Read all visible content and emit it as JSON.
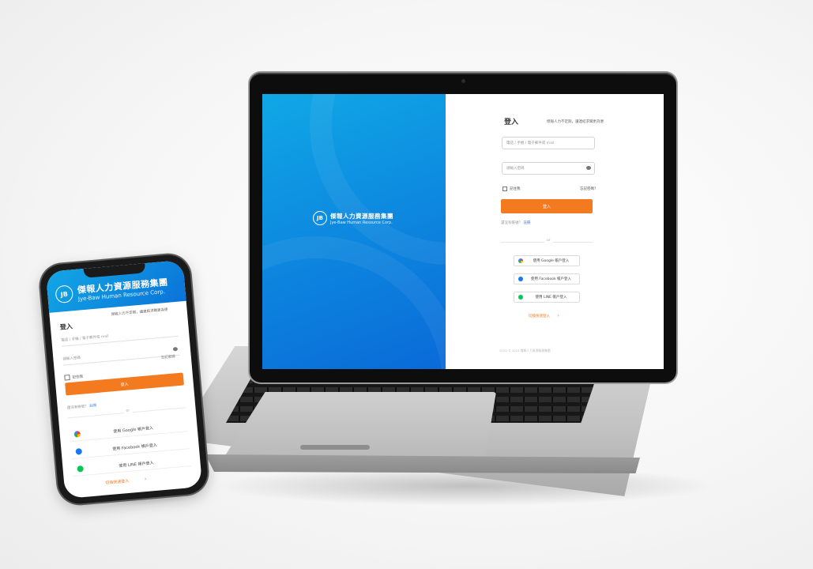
{
  "brand": {
    "name_cn": "傑報人力資源服務集團",
    "name_en": "Jye-Baw Human Resource Corp.",
    "logo_text": "JB"
  },
  "login": {
    "title": "登入",
    "subtitle": "傑報人力不定期，讓連結求職更為便",
    "account_placeholder": "電話 / 手機 / 電子郵件或 mail",
    "password_placeholder": "請輸入密碼",
    "remember_label": "記住我",
    "forgot_label": "忘記密碼？",
    "login_button": "登入",
    "no_account_text": "還沒有帳號？",
    "register_link": "註冊",
    "or_text": "or",
    "social_google": "使用 Google 帳戶登入",
    "social_facebook": "使用 Facebook 帳戶登入",
    "social_line": "使用 LINE 帳戶登入",
    "quick_link": "切換快速登入",
    "copyright": "2020 © 2024 傑報人力資源服務集團"
  },
  "mobile": {
    "title": "登入",
    "subtitle": "傑報人力不定期，讓連結求職更為便",
    "account_placeholder": "電話 / 手機 / 電子郵件或 mail",
    "password_placeholder": "請輸入密碼",
    "remember_label": "記住我",
    "forgot_label": "忘記密碼",
    "login_button": "登入",
    "no_account_text": "還沒有帳號？",
    "register_link": "註冊",
    "or_text": "or",
    "social_google": "使用 Google 帳戶登入",
    "social_facebook": "使用 Facebook 帳戶登入",
    "social_line": "使用 LINE 帳戶登入",
    "quick_link": "切換快速登入"
  },
  "colors": {
    "accent": "#f47a20",
    "brand_blue": "#0d8be0",
    "link": "#3a7bd5"
  },
  "icons": {
    "google": "google-icon",
    "facebook": "facebook-icon",
    "line": "line-icon",
    "eye": "eye-icon",
    "arrow": "chevron-right-icon"
  }
}
